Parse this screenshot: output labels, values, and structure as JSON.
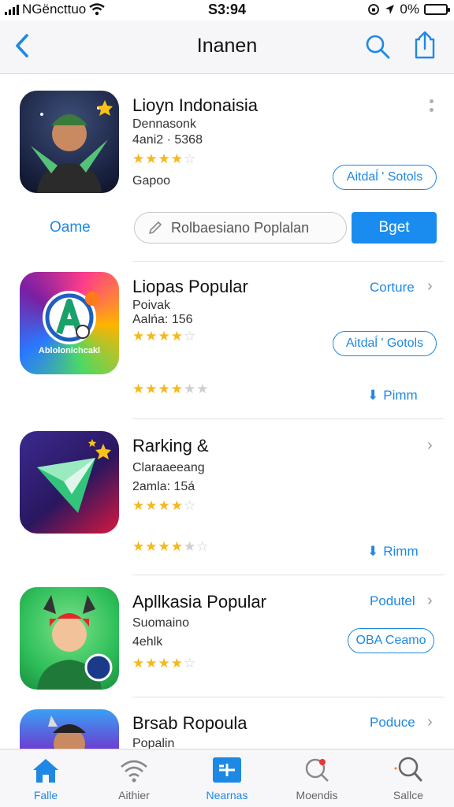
{
  "status_bar": {
    "carrier": "NGëncttuo",
    "time": "S3:94",
    "battery": "0%"
  },
  "nav": {
    "title": "Inanen"
  },
  "action_row": {
    "game_link": "Oame",
    "search_placeholder": "Rolbaesiano Poplalan",
    "get_label": "Bget"
  },
  "apps": [
    {
      "name": "Lioyn Indonaisia",
      "developer": "Dennasonk",
      "meta": "4ani2 · 5368",
      "rating": 4,
      "extra": "Gapoo",
      "pill": "Aitdaĺ ' Sotols",
      "link": "",
      "rating2": null,
      "action": ""
    },
    {
      "name": "Liopas Popular",
      "developer": "Poivak",
      "meta": "Aalńa: 156",
      "rating": 4,
      "extra": "",
      "pill": "Aitdaĺ ' Gotols",
      "link": "Corture",
      "rating2": 3.5,
      "action": "Pimm",
      "icon_text": "Ablolonichcakl"
    },
    {
      "name": "Rarking &",
      "developer": "Claraaeeang",
      "meta": "2amla: 15á",
      "rating": 3.5,
      "extra": "",
      "pill": "",
      "link": "",
      "rating2": 3.5,
      "action": "Rimm"
    },
    {
      "name": "Apllkasia Popular",
      "developer": "Suomaino",
      "meta": "4ehlk",
      "rating": 4,
      "extra": "",
      "pill": "OBA Ceamo",
      "link": "Podutel",
      "rating2": null,
      "action": ""
    },
    {
      "name": "Brsab Ropoula",
      "developer": "Popalin",
      "meta": "",
      "rating": null,
      "extra": "",
      "pill": "",
      "link": "Poduce",
      "rating2": null,
      "action": ""
    }
  ],
  "tabs": [
    {
      "label": "Falle",
      "icon": "home-icon",
      "active": false
    },
    {
      "label": "Aithier",
      "icon": "wifi-icon",
      "active": false
    },
    {
      "label": "Nearnas",
      "icon": "apps-icon",
      "active": true
    },
    {
      "label": "Moendis",
      "icon": "map-pin-icon",
      "active": false
    },
    {
      "label": "Sallce",
      "icon": "search-icon",
      "active": false
    }
  ],
  "colors": {
    "accent": "#1e88e5",
    "star": "#f6b81c",
    "button": "#1a8cf0"
  }
}
